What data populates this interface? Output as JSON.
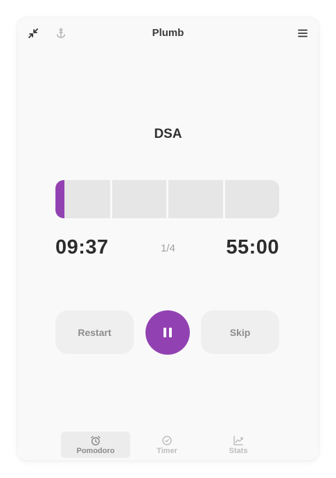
{
  "window": {
    "title": "Plumb"
  },
  "titlebar": {
    "left_icons": [
      "collapse-icon",
      "anchor-icon"
    ],
    "right_icon": "menu-icon"
  },
  "task": {
    "name": "DSA"
  },
  "progress": {
    "segments": 4,
    "current_segment": 1,
    "current_segment_fill": 0.17
  },
  "timer": {
    "elapsed": "09:37",
    "session_count": "1/4",
    "total": "55:00"
  },
  "controls": {
    "restart_label": "Restart",
    "pause_icon": "pause-icon",
    "skip_label": "Skip"
  },
  "nav": {
    "items": [
      {
        "label": "Pomodoro",
        "icon": "alarm-clock-icon",
        "active": true
      },
      {
        "label": "Timer",
        "icon": "clock-icon",
        "active": false
      },
      {
        "label": "Stats",
        "icon": "chart-icon",
        "active": false
      }
    ]
  },
  "colors": {
    "accent": "#9241b2",
    "segment_bg": "#e6e6e6",
    "background": "#f9f9f9"
  }
}
